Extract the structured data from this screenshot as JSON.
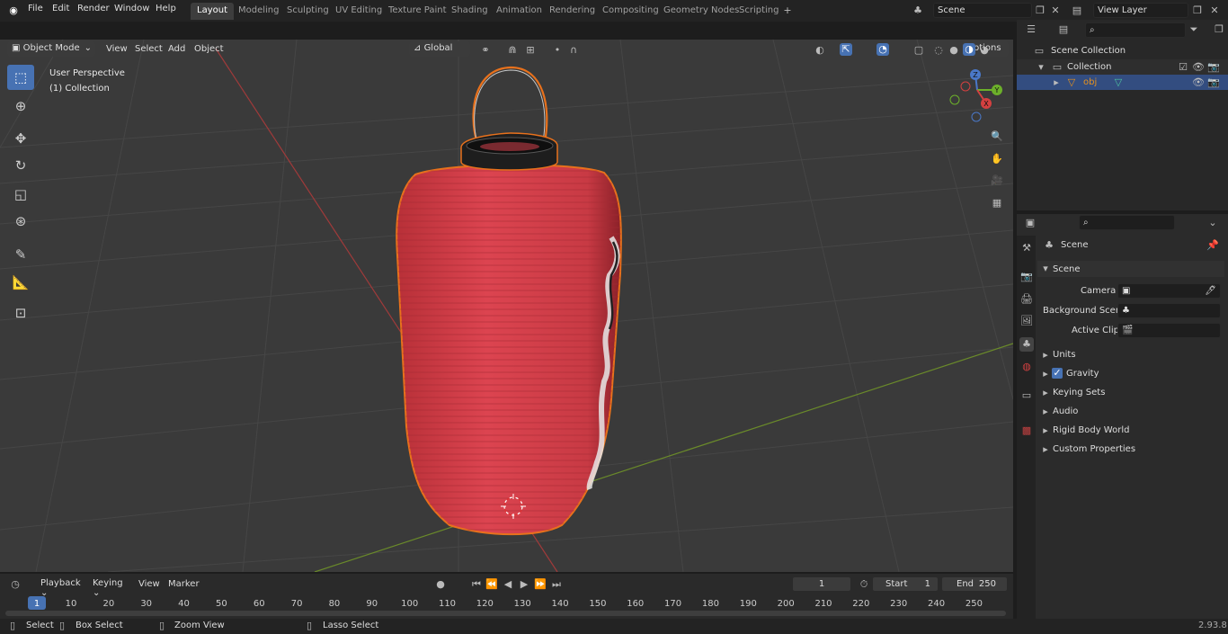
{
  "menu": {
    "file": "File",
    "edit": "Edit",
    "render": "Render",
    "window": "Window",
    "help": "Help"
  },
  "workspaces": [
    "Layout",
    "Modeling",
    "Sculpting",
    "UV Editing",
    "Texture Paint",
    "Shading",
    "Animation",
    "Rendering",
    "Compositing",
    "Geometry Nodes",
    "Scripting"
  ],
  "scene_name": "Scene",
  "view_layer": "View Layer",
  "viewport": {
    "mode": "Object Mode",
    "view": "View",
    "select": "Select",
    "add": "Add",
    "object": "Object",
    "transform_orientation": "Global",
    "options": "Options",
    "perspective_label": "User Perspective",
    "collection_label": "(1) Collection"
  },
  "gizmo": {
    "z": "Z",
    "y": "Y",
    "x": "X"
  },
  "outliner": {
    "scene_collection": "Scene Collection",
    "collection": "Collection",
    "object": "obj"
  },
  "properties": {
    "header": "Scene",
    "panel": "Scene",
    "camera_label": "Camera",
    "background_scene_label": "Background Scene",
    "active_clip_label": "Active Clip",
    "units": "Units",
    "gravity": "Gravity",
    "keying_sets": "Keying Sets",
    "audio": "Audio",
    "rigid_body_world": "Rigid Body World",
    "custom_properties": "Custom Properties"
  },
  "timeline": {
    "playback": "Playback",
    "keying": "Keying",
    "view": "View",
    "marker": "Marker",
    "current_frame": "1",
    "start_label": "Start",
    "start": "1",
    "end_label": "End",
    "end": "250",
    "ticks": [
      "1",
      "10",
      "20",
      "30",
      "40",
      "50",
      "60",
      "70",
      "80",
      "90",
      "100",
      "110",
      "120",
      "130",
      "140",
      "150",
      "160",
      "170",
      "180",
      "190",
      "200",
      "210",
      "220",
      "230",
      "240",
      "250"
    ]
  },
  "status": {
    "select": "Select",
    "box_select": "Box Select",
    "zoom_view": "Zoom View",
    "lasso_select": "Lasso Select",
    "version": "2.93.8"
  },
  "colors": {
    "accent": "#4772b3",
    "selection_outline": "#e8711c",
    "lantern": "#d8404a"
  }
}
